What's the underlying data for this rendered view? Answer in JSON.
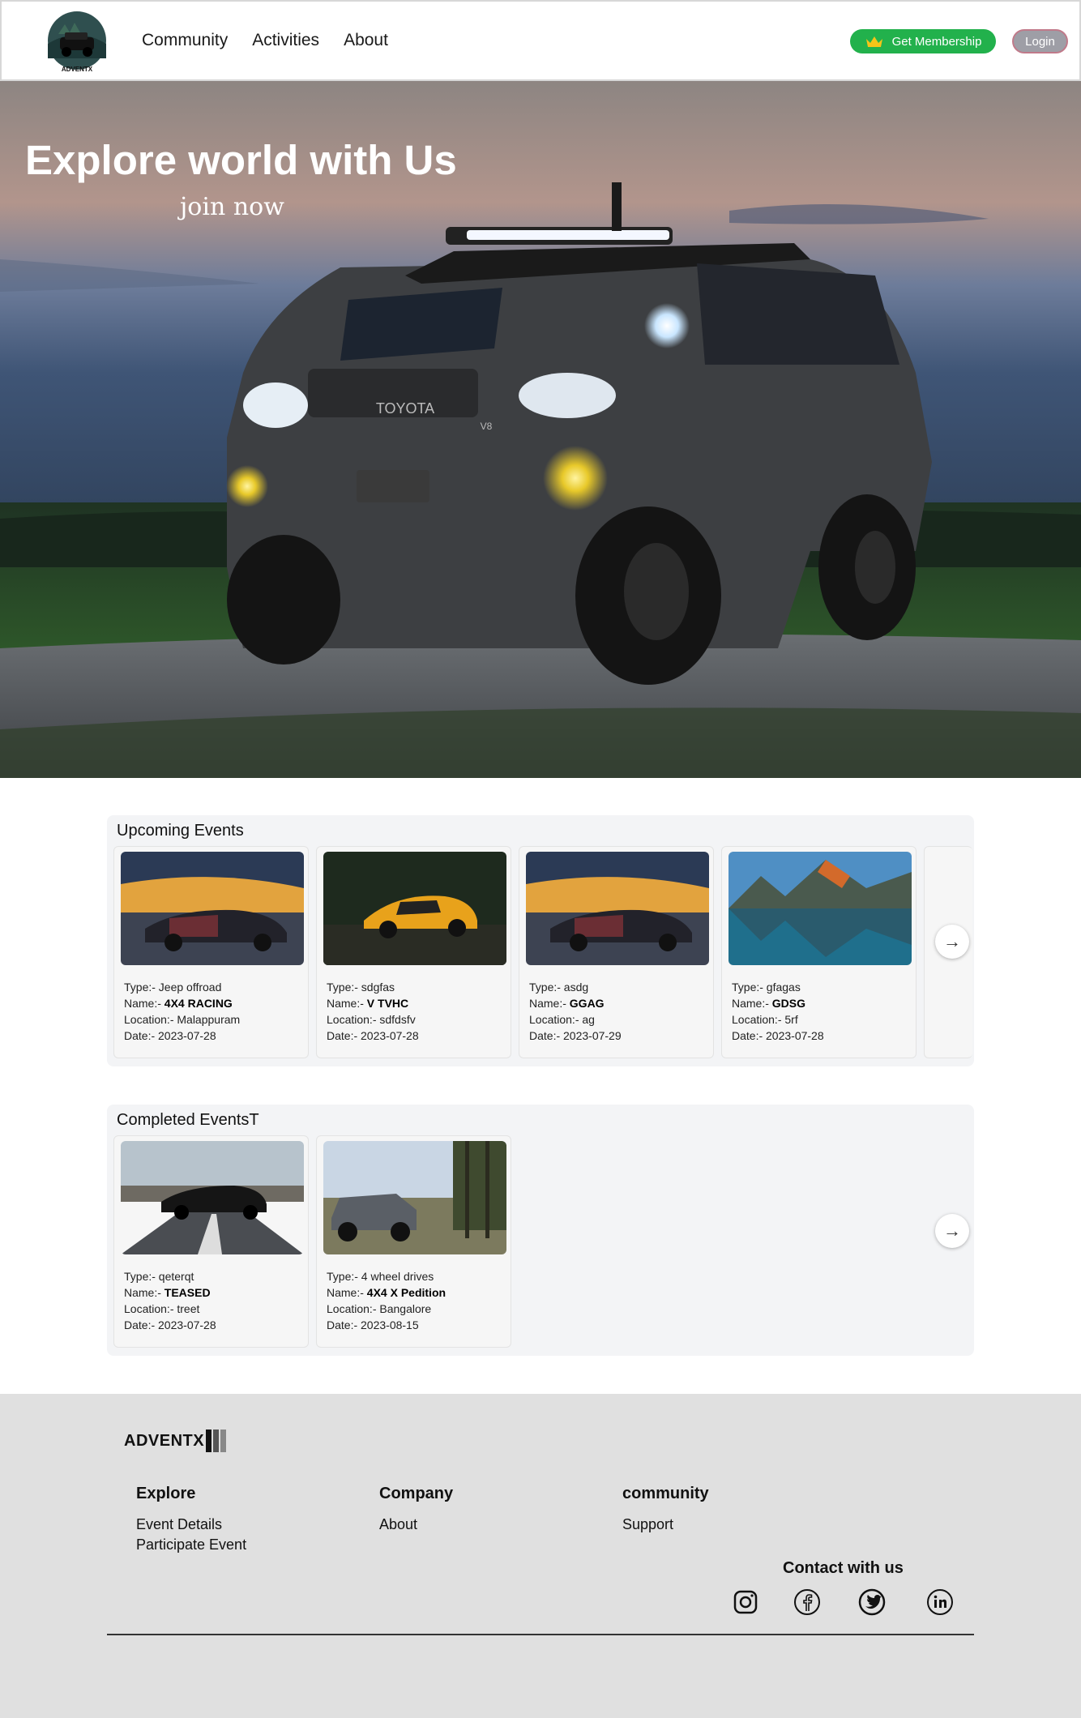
{
  "nav": {
    "logo_text": "ADVENTX",
    "links": [
      "Community",
      "Activities",
      "About"
    ],
    "membership_label": "Get Membership",
    "login_label": "Login"
  },
  "hero": {
    "title": "Explore world with Us",
    "subtitle": "join now",
    "car_badge": "TOYOTA",
    "car_engine_badge": "V8"
  },
  "upcoming": {
    "title": "Upcoming Events",
    "events": [
      {
        "type": "Jeep offroad",
        "name": "4X4 RACING",
        "location": "Malappuram",
        "date": "2023-07-28",
        "image": "dark-sportscar-sunset"
      },
      {
        "type": "sdgfas",
        "name": "V TVHC",
        "location": "sdfdsfv",
        "date": "2023-07-28",
        "image": "yellow-sportscar-forest"
      },
      {
        "type": "asdg",
        "name": "GGAG",
        "location": "ag",
        "date": "2023-07-29",
        "image": "dark-sportscar-sunset"
      },
      {
        "type": "gfagas",
        "name": "GDSG",
        "location": "5rf",
        "date": "2023-07-28",
        "image": "mountain-lake"
      }
    ]
  },
  "completed": {
    "title": "Completed EventsT",
    "events": [
      {
        "type": "qeterqt",
        "name": "TEASED",
        "location": "treet",
        "date": "2023-07-28",
        "image": "black-muscle-car-road"
      },
      {
        "type": "4 wheel drives",
        "name": "4X4 X Pedition",
        "location": "Bangalore",
        "date": "2023-08-15",
        "image": "suv-offroad-forest"
      }
    ]
  },
  "labels": {
    "type": "Type:- ",
    "name": "Name:- ",
    "location": "Location:- ",
    "date": "Date:- "
  },
  "footer": {
    "logo_text": "ADVENTX",
    "columns": [
      {
        "heading": "Explore",
        "links": [
          "Event Details",
          "Participate Event"
        ]
      },
      {
        "heading": "Company",
        "links": [
          "About"
        ]
      },
      {
        "heading": "community",
        "links": [
          "Support"
        ]
      }
    ],
    "contact_title": "Contact with us",
    "socials": [
      "instagram-icon",
      "facebook-icon",
      "twitter-icon",
      "linkedin-icon"
    ]
  },
  "colors": {
    "membership": "#22b14c",
    "login": "#9e9ea6",
    "section_bg": "#f3f4f6",
    "footer_bg": "#e0e0e0"
  }
}
